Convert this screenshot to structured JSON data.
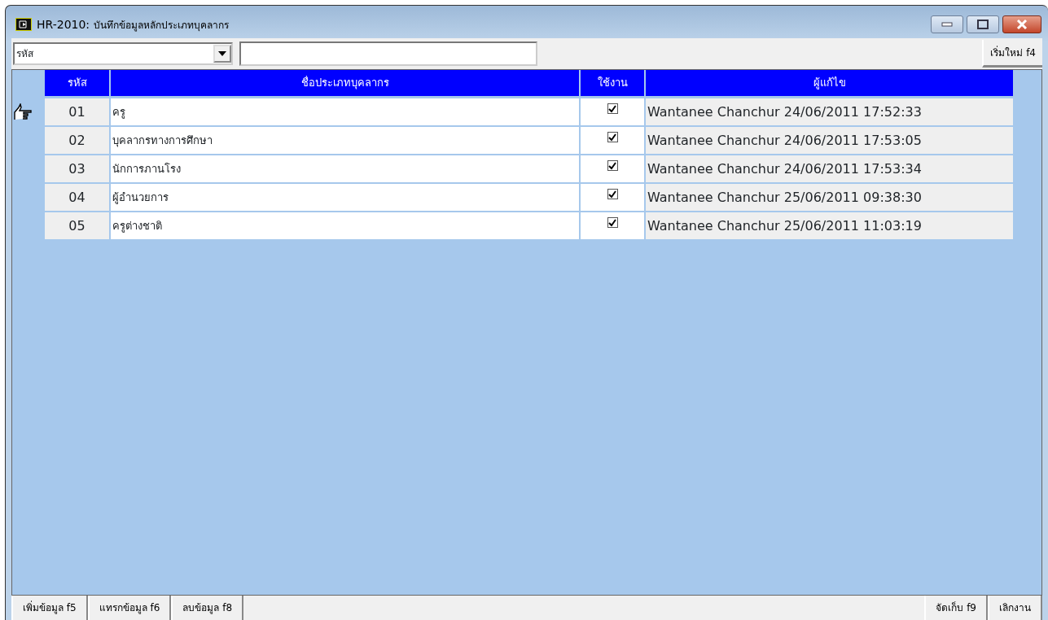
{
  "window": {
    "title_code": "HR-2010:",
    "title": "บันทึกข้อมูลหลักประเภทบุคลากร"
  },
  "search": {
    "field_value": "รหัส"
  },
  "toolbar": {
    "reset_button": "เริ่มใหม่ f4"
  },
  "table": {
    "columns": [
      "รหัส",
      "ชื่อประเภทบุคลากร",
      "ใช้งาน",
      "ผู้แก้ไข"
    ],
    "rows": [
      {
        "code": "01",
        "name": "ครู",
        "checked": true,
        "editor": "Wantanee Chanchur 24/06/2011 17:52:33",
        "selected": true
      },
      {
        "code": "02",
        "name": "บุคลากรทางการศึกษา",
        "checked": true,
        "editor": "Wantanee Chanchur 24/06/2011 17:53:05",
        "selected": false
      },
      {
        "code": "03",
        "name": "นักการภานโรง",
        "checked": true,
        "editor": "Wantanee Chanchur 24/06/2011 17:53:34",
        "selected": false
      },
      {
        "code": "04",
        "name": "ผู้อำนวยการ",
        "checked": true,
        "editor": "Wantanee Chanchur 25/06/2011 09:38:30",
        "selected": false
      },
      {
        "code": "05",
        "name": "ครูต่างชาติ",
        "checked": true,
        "editor": "Wantanee Chanchur 25/06/2011 11:03:19",
        "selected": false
      }
    ]
  },
  "buttons_left": [
    "เพิ่มข้อมูล f5",
    "แทรกข้อมูล f6",
    "ลบข้อมูล f8"
  ],
  "buttons_right": [
    "จัดเก็บ f9",
    "เลิกงาน"
  ]
}
